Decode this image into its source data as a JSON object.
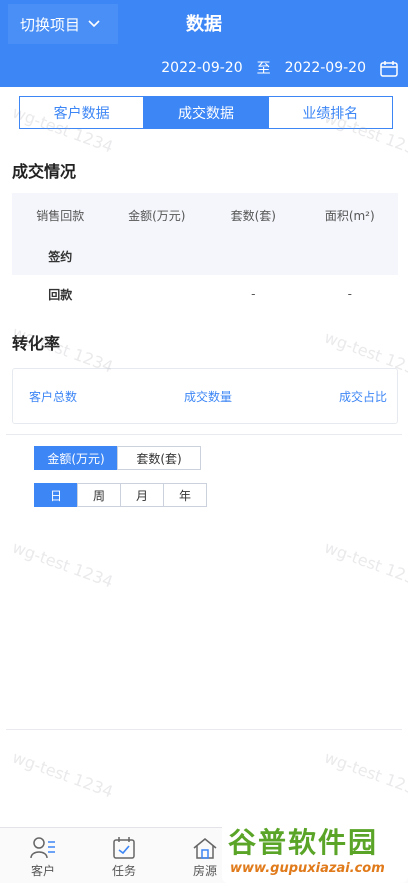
{
  "header": {
    "project_switch_label": "切换项目",
    "title": "数据",
    "date_start": "2022-09-20",
    "date_separator": "至",
    "date_end": "2022-09-20",
    "color": "#3d86f5"
  },
  "tabs": [
    "客户数据",
    "成交数据",
    "业绩排名"
  ],
  "active_tab": "成交数据",
  "deal_section": {
    "title": "成交情况",
    "columns": [
      "销售回款",
      "金额(万元)",
      "套数(套)",
      "面积(m²)"
    ],
    "rows": [
      {
        "label": "签约",
        "amount": "",
        "units": "",
        "area": ""
      },
      {
        "label": "回款",
        "amount": "",
        "units": "-",
        "area": "-"
      }
    ]
  },
  "conversion_section": {
    "title": "转化率",
    "items": [
      "客户总数",
      "成交数量",
      "成交占比"
    ]
  },
  "metric_toggle": {
    "options": [
      "金额(万元)",
      "套数(套)"
    ],
    "selected": "金额(万元)"
  },
  "period_toggle": {
    "options": [
      "日",
      "周",
      "月",
      "年"
    ],
    "selected": "日"
  },
  "watermark_text": "wg-test 1234",
  "bottom_nav": {
    "items": [
      {
        "label": "客户",
        "icon": "user-list-icon"
      },
      {
        "label": "任务",
        "icon": "calendar-check-icon"
      },
      {
        "label": "房源",
        "icon": "house-icon"
      }
    ]
  },
  "site_logo": {
    "title": "谷普软件园",
    "url": "www.gupuxiazai.com"
  }
}
